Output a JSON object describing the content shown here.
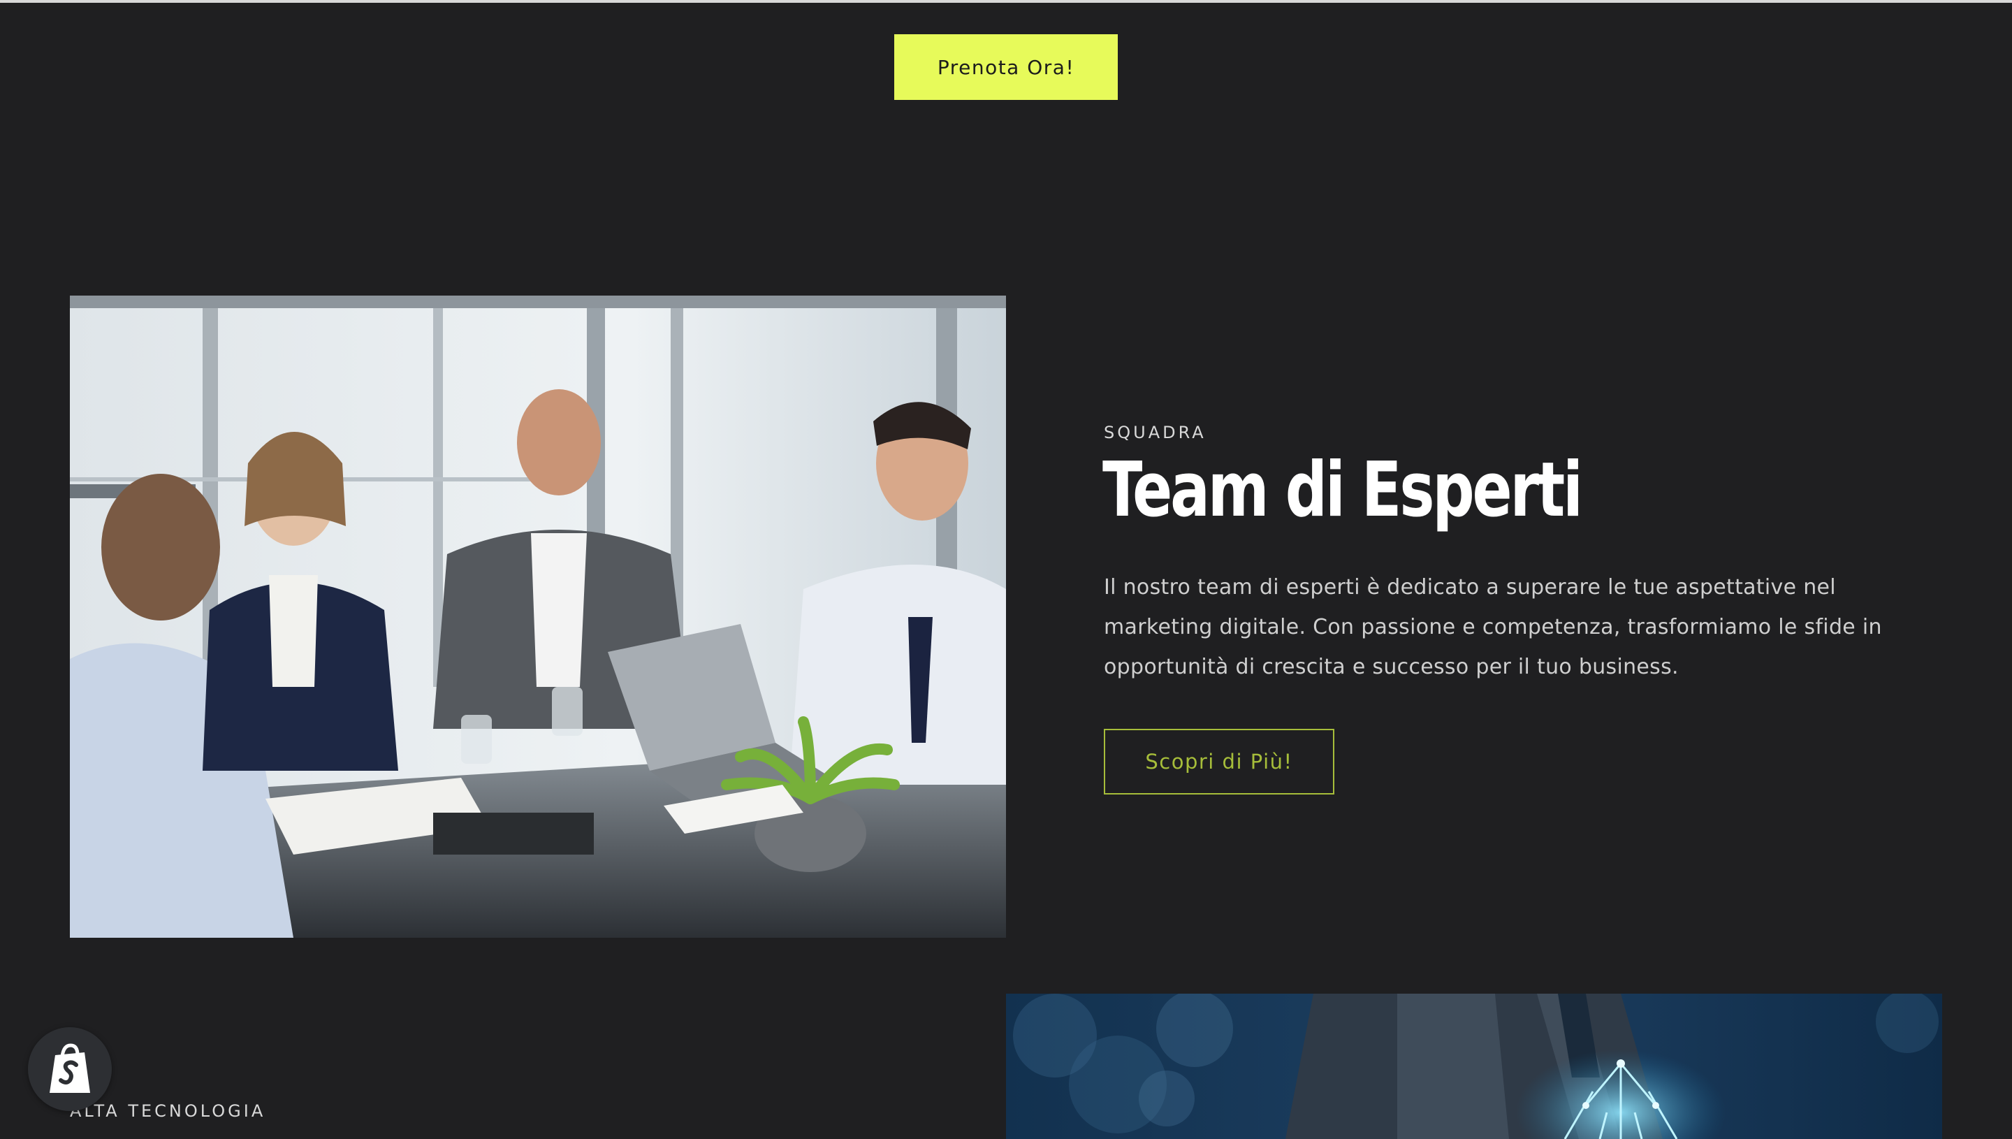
{
  "header": {
    "cta_label": "Prenota Ora!"
  },
  "team_section": {
    "eyebrow": "SQUADRA",
    "title": "Team di Esperti",
    "description": "Il nostro team di esperti è dedicato a superare le tue aspettative nel marketing digitale. Con passione e competenza, trasformiamo le sfide in opportunità di crescita e successo per il tuo business.",
    "button_label": "Scopri di Più!",
    "image_icon": "business-meeting-photo"
  },
  "tech_section": {
    "eyebrow": "ALTA TECNOLOGIA",
    "image_icon": "businessman-circuit-photo"
  },
  "badge": {
    "icon": "shopify-bag-icon"
  },
  "colors": {
    "background": "#1f1f21",
    "accent": "#e7fa5a",
    "outline_button": "#a6bd3a"
  }
}
